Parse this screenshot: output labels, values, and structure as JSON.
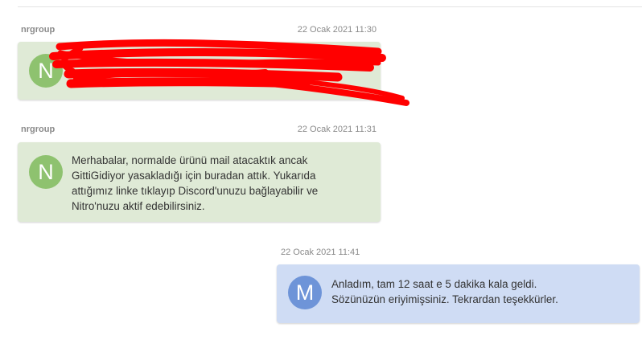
{
  "messages": [
    {
      "sender": "nrgroup",
      "timestamp": "22 Ocak 2021 11:30",
      "avatar_letter": "N",
      "text": "",
      "redacted": true
    },
    {
      "sender": "nrgroup",
      "timestamp": "22 Ocak 2021 11:31",
      "avatar_letter": "N",
      "text_lines": [
        "Merhabalar, normalde ürünü mail atacaktık ancak",
        "GittiGidiyor yasakladığı için buradan attık. Yukarıda",
        "attığımız linke tıklayıp Discord'unuzu bağlayabilir ve",
        "Nitro'nuzu aktif edebilirsiniz."
      ]
    },
    {
      "sender": "",
      "timestamp": "22 Ocak 2021 11:41",
      "avatar_letter": "M",
      "text_lines": [
        "Anladım, tam 12 saat e 5 dakika kala geldi.",
        "Sözünüzün eriyimişsiniz. Tekrardan teşekkürler."
      ]
    }
  ],
  "colors": {
    "incoming_bubble": "#dfead6",
    "outgoing_bubble": "#cfdcf4",
    "incoming_avatar": "#8ec26f",
    "outgoing_avatar": "#6e94d8",
    "redaction": "#ff0000"
  }
}
